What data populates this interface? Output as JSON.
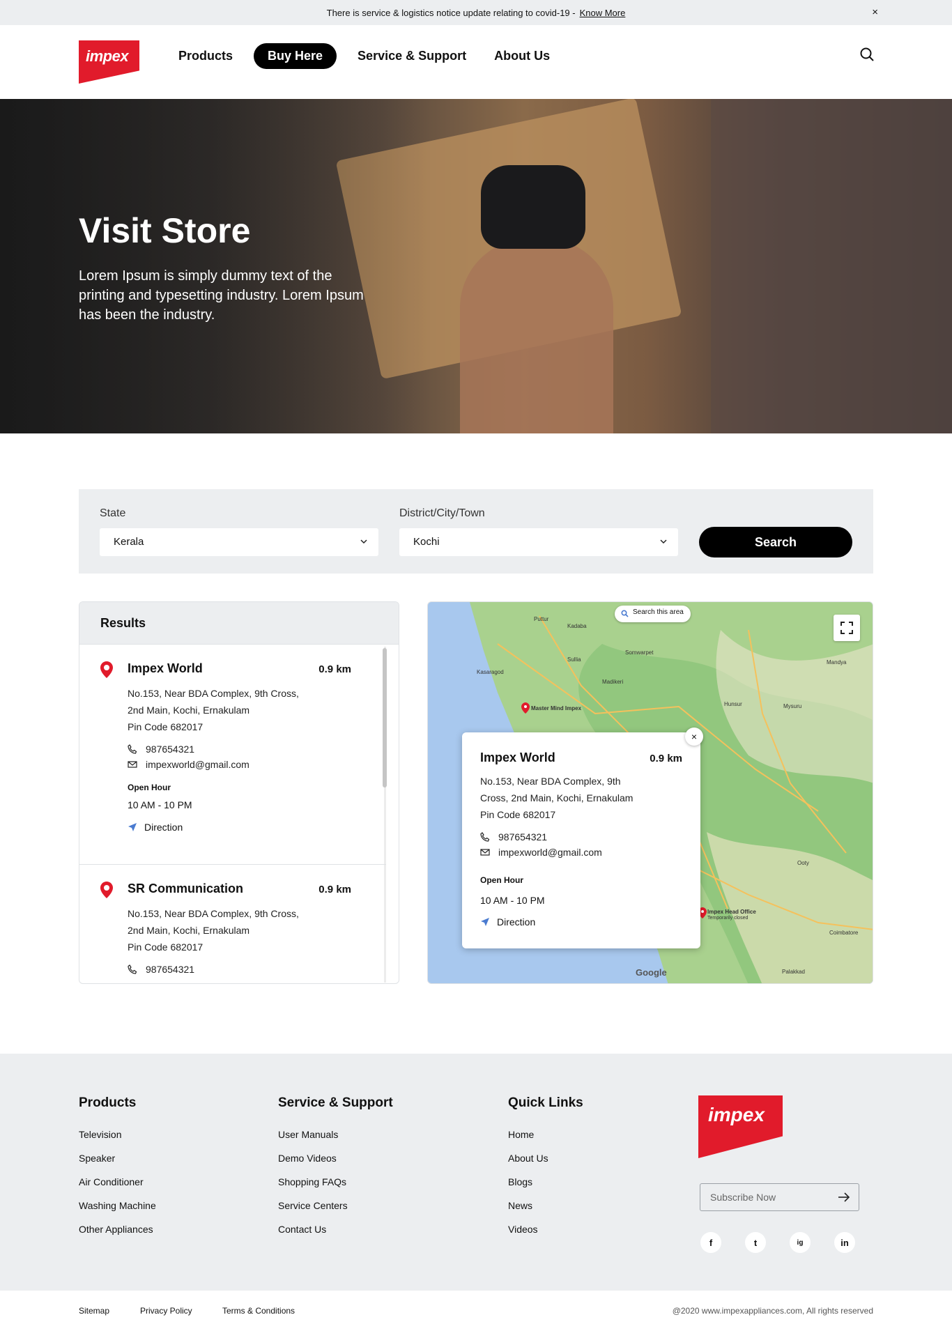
{
  "notice": {
    "text": "There is service & logistics notice update relating to covid-19 -",
    "link": "Know More",
    "close": "×"
  },
  "header": {
    "logo": "impex",
    "nav": [
      "Products",
      "Buy Here",
      "Service & Support",
      "About Us"
    ],
    "active_nav": "Buy Here"
  },
  "hero": {
    "title": "Visit Store",
    "text": "Lorem Ipsum is simply dummy text of the printing and typesetting industry. Lorem Ipsum has been the industry."
  },
  "filter": {
    "state_label": "State",
    "state_value": "Kerala",
    "district_label": "District/City/Town",
    "district_value": "Kochi",
    "search_button": "Search"
  },
  "results": {
    "title": "Results",
    "stores": [
      {
        "name": "Impex World",
        "distance": "0.9 km",
        "address": "No.153, Near BDA Complex, 9th Cross, 2nd Main, Kochi, Ernakulam",
        "pin": "Pin Code 682017",
        "phone": "987654321",
        "email": "impexworld@gmail.com",
        "open_hour_label": "Open Hour",
        "hours": "10 AM - 10 PM",
        "direction": "Direction"
      },
      {
        "name": "SR Communication",
        "distance": "0.9 km",
        "address": "No.153, Near BDA Complex, 9th Cross, 2nd Main, Kochi, Ernakulam",
        "pin": "Pin Code 682017",
        "phone": "987654321"
      }
    ]
  },
  "map": {
    "search_area": "Search this area",
    "google": "Google",
    "labels": {
      "master_mind": "Master Mind Impex",
      "head_office": "Impex Head Office",
      "head_office_sub": "Temporarily closed",
      "kasaragod": "Kasaragod",
      "puttur": "Puttur",
      "madikeri": "Madikeri",
      "mysuru": "Mysuru",
      "mandya": "Mandya",
      "hunsur": "Hunsur",
      "coimbatore": "Coimbatore",
      "palakkad": "Palakkad",
      "ooty": "Ooty",
      "sullia": "Sullia",
      "kadaba": "Kadaba",
      "somwarpet": "Somwarpet"
    },
    "popup": {
      "name": "Impex World",
      "distance": "0.9 km",
      "address": "No.153, Near BDA Complex, 9th Cross, 2nd Main, Kochi, Ernakulam",
      "pin": "Pin Code 682017",
      "phone": "987654321",
      "email": "impexworld@gmail.com",
      "open_hour_label": "Open Hour",
      "hours": "10 AM - 10 PM",
      "direction": "Direction",
      "close": "×"
    }
  },
  "footer": {
    "products": {
      "title": "Products",
      "links": [
        "Television",
        "Speaker",
        "Air Conditioner",
        "Washing Machine",
        "Other Appliances"
      ]
    },
    "service": {
      "title": "Service & Support",
      "links": [
        "User Manuals",
        "Demo Videos",
        "Shopping FAQs",
        "Service Centers",
        "Contact Us"
      ]
    },
    "quick": {
      "title": "Quick Links",
      "links": [
        "Home",
        "About Us",
        "Blogs",
        "News",
        "Videos"
      ]
    },
    "logo": "impex",
    "subscribe_placeholder": "Subscribe Now",
    "social": [
      "f",
      "t",
      "ig",
      "in"
    ]
  },
  "bottom": {
    "links": [
      "Sitemap",
      "Privacy Policy",
      "Terms & Conditions"
    ],
    "copyright": "@2020 www.impexappliances.com, All rights reserved"
  },
  "colors": {
    "brand": "#e11b2b",
    "dark": "#000000",
    "light_bg": "#eceef0",
    "direction_icon": "#4a7bd0"
  }
}
